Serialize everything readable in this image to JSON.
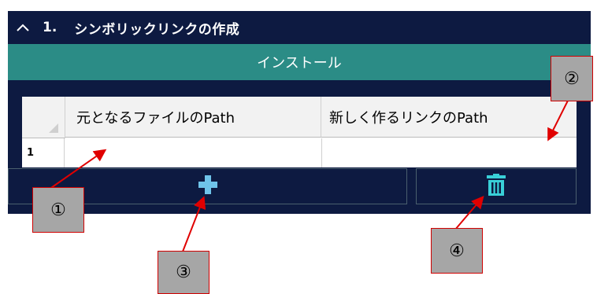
{
  "section": {
    "chevron_icon": "chevron-up-icon",
    "number": "1.",
    "title": "シンボリックリンクの作成"
  },
  "install_bar": {
    "label": "インストール"
  },
  "grid": {
    "columns": [
      "元となるファイルのPath",
      "新しく作るリンクのPath"
    ],
    "rows": [
      {
        "number": "1",
        "cells": [
          "",
          ""
        ]
      }
    ]
  },
  "buttons": {
    "add_icon": "plus-icon",
    "delete_icon": "trash-icon"
  },
  "callouts": [
    "①",
    "②",
    "③",
    "④"
  ],
  "colors": {
    "panel_bg": "#0d1a41",
    "install_bar_bg": "#2b8c86",
    "add_icon": "#6fc4ea",
    "delete_icon": "#39d0d8",
    "arrow": "#e00000",
    "callout_bg": "#a6a6a6"
  }
}
